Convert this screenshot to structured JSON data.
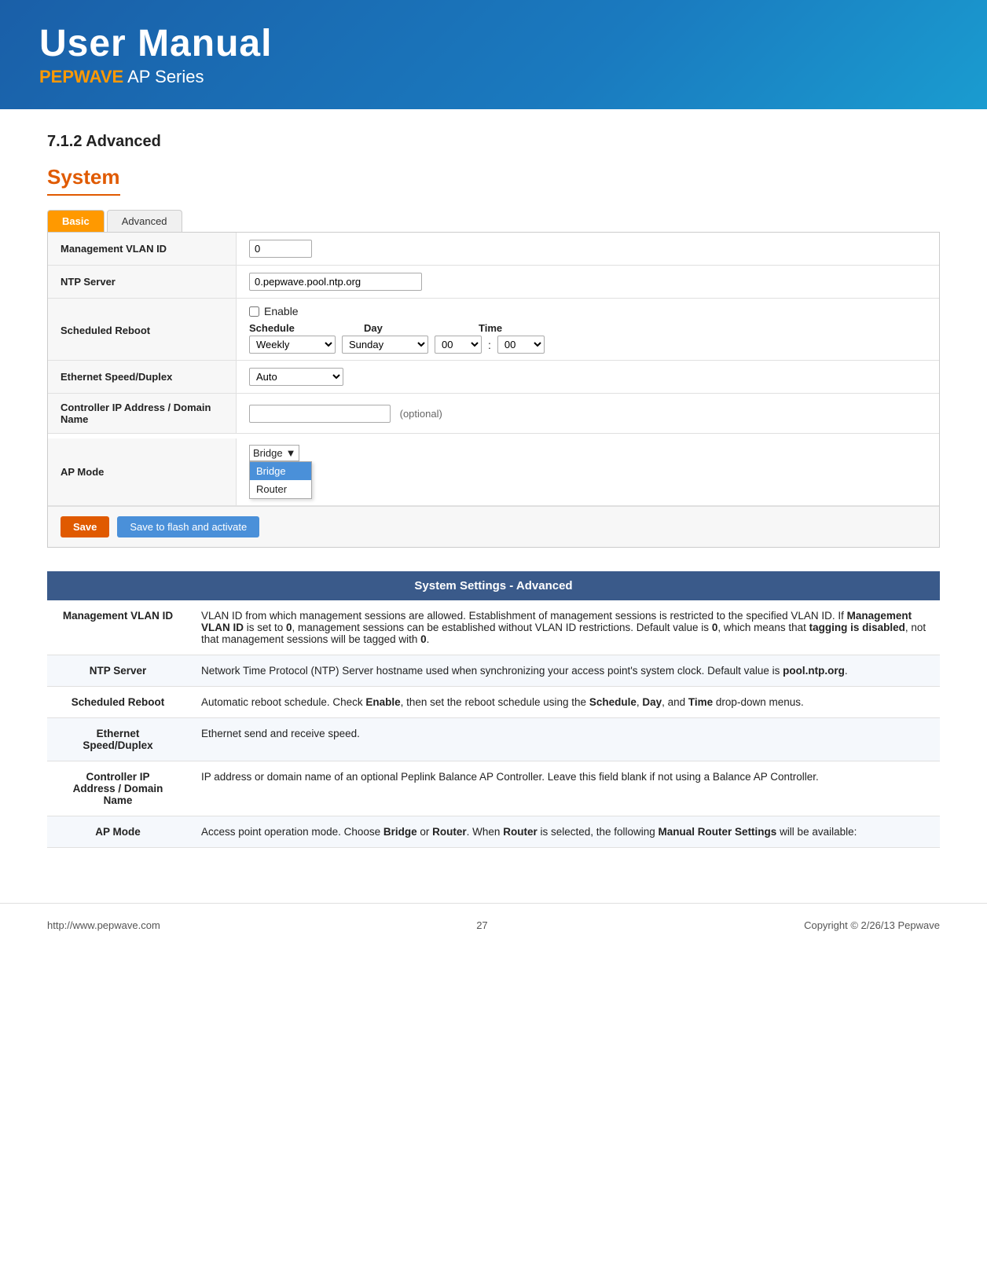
{
  "header": {
    "title": "User Manual",
    "subtitle_brand": "PEPWAVE",
    "subtitle_rest": " AP Series"
  },
  "content": {
    "section_heading": "7.1.2 Advanced",
    "system_label": "System",
    "tabs": [
      {
        "label": "Basic",
        "active": true
      },
      {
        "label": "Advanced",
        "active": false
      }
    ],
    "form": {
      "rows": [
        {
          "label": "Management VLAN ID",
          "type": "text",
          "value": "0"
        },
        {
          "label": "NTP Server",
          "type": "text",
          "value": "0.pepwave.pool.ntp.org"
        },
        {
          "label": "Scheduled Reboot",
          "type": "scheduled_reboot",
          "enable_label": "Enable",
          "schedule_label": "Schedule",
          "day_label": "Day",
          "time_label": "Time",
          "schedule_value": "Weekly",
          "day_value": "Sunday",
          "hour_value": "00",
          "minute_value": "00"
        },
        {
          "label": "Ethernet Speed/Duplex",
          "type": "select",
          "value": "Auto"
        },
        {
          "label": "Controller IP Address / Domain Name",
          "type": "text_optional",
          "value": "",
          "optional_text": "(optional)"
        },
        {
          "label": "AP Mode",
          "type": "ap_mode",
          "value": "Bridge",
          "options": [
            "Bridge",
            "Router"
          ]
        }
      ],
      "save_button": "Save",
      "save_flash_button": "Save to flash and activate"
    },
    "desc_table": {
      "header": "System Settings - Advanced",
      "rows": [
        {
          "field": "Management VLAN ID",
          "description": "VLAN ID from which management sessions are allowed. Establishment of management sessions is restricted to the specified VLAN ID. If Management VLAN ID is set to 0, management sessions can be established without VLAN ID restrictions. Default value is 0, which means that tagging is disabled, not that management sessions will be tagged with 0."
        },
        {
          "field": "NTP Server",
          "description": "Network Time Protocol (NTP) Server hostname used when synchronizing your access point's system clock. Default value is pool.ntp.org."
        },
        {
          "field": "Scheduled Reboot",
          "description": "Automatic reboot schedule. Check Enable, then set the reboot schedule using the Schedule, Day, and Time drop-down menus."
        },
        {
          "field": "Ethernet Speed/Duplex",
          "description": "Ethernet send and receive speed."
        },
        {
          "field": "Controller IP Address / Domain Name",
          "description": "IP address or domain name of an optional Peplink Balance AP Controller. Leave this field blank if not using a Balance AP Controller."
        },
        {
          "field": "AP Mode",
          "description": "Access point operation mode. Choose Bridge or Router. When Router is selected, the following Manual Router Settings will be available:"
        }
      ]
    }
  },
  "footer": {
    "url": "http://www.pepwave.com",
    "page_number": "27",
    "copyright": "Copyright © 2/26/13 Pepwave"
  }
}
